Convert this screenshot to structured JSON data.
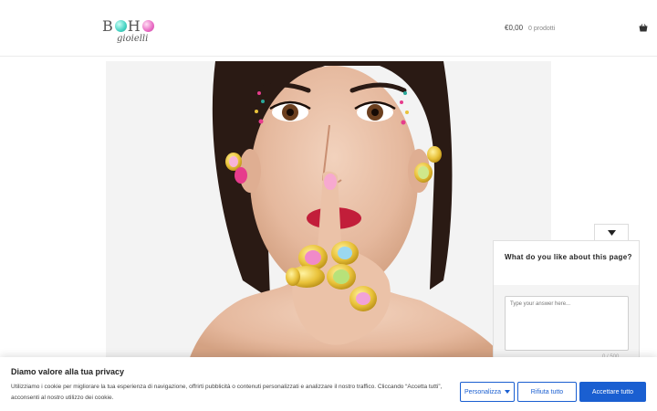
{
  "header": {
    "logo": {
      "main_letters": [
        "B",
        "H"
      ],
      "sub_text": "gioielli"
    },
    "cart": {
      "price": "€0,00",
      "count": "0 prodotti",
      "icon": "basket-icon"
    }
  },
  "hero": {
    "image": "woman-with-colorful-rings-photo"
  },
  "feedback": {
    "toggle_icon": "caret-down-icon",
    "question": "What do you like about this page?",
    "placeholder": "Type your answer here...",
    "counter": "0 / 500"
  },
  "cookie": {
    "title": "Diamo valore alla tua privacy",
    "text": "Utilizziamo i cookie per migliorare la tua esperienza di navigazione, offrirti pubblicità o contenuti personalizzati e analizzare il nostro traffico. Cliccando “Accetta tutti”, acconsenti al nostro utilizzo dei cookie.",
    "customize_label": "Personalizza",
    "reject_label": "Rifiuta tutto",
    "accept_label": "Accettare tutto"
  },
  "colors": {
    "accent": "#1a5fd1",
    "gem_teal": "#46d3c3",
    "gem_pink": "#e96ac4"
  }
}
